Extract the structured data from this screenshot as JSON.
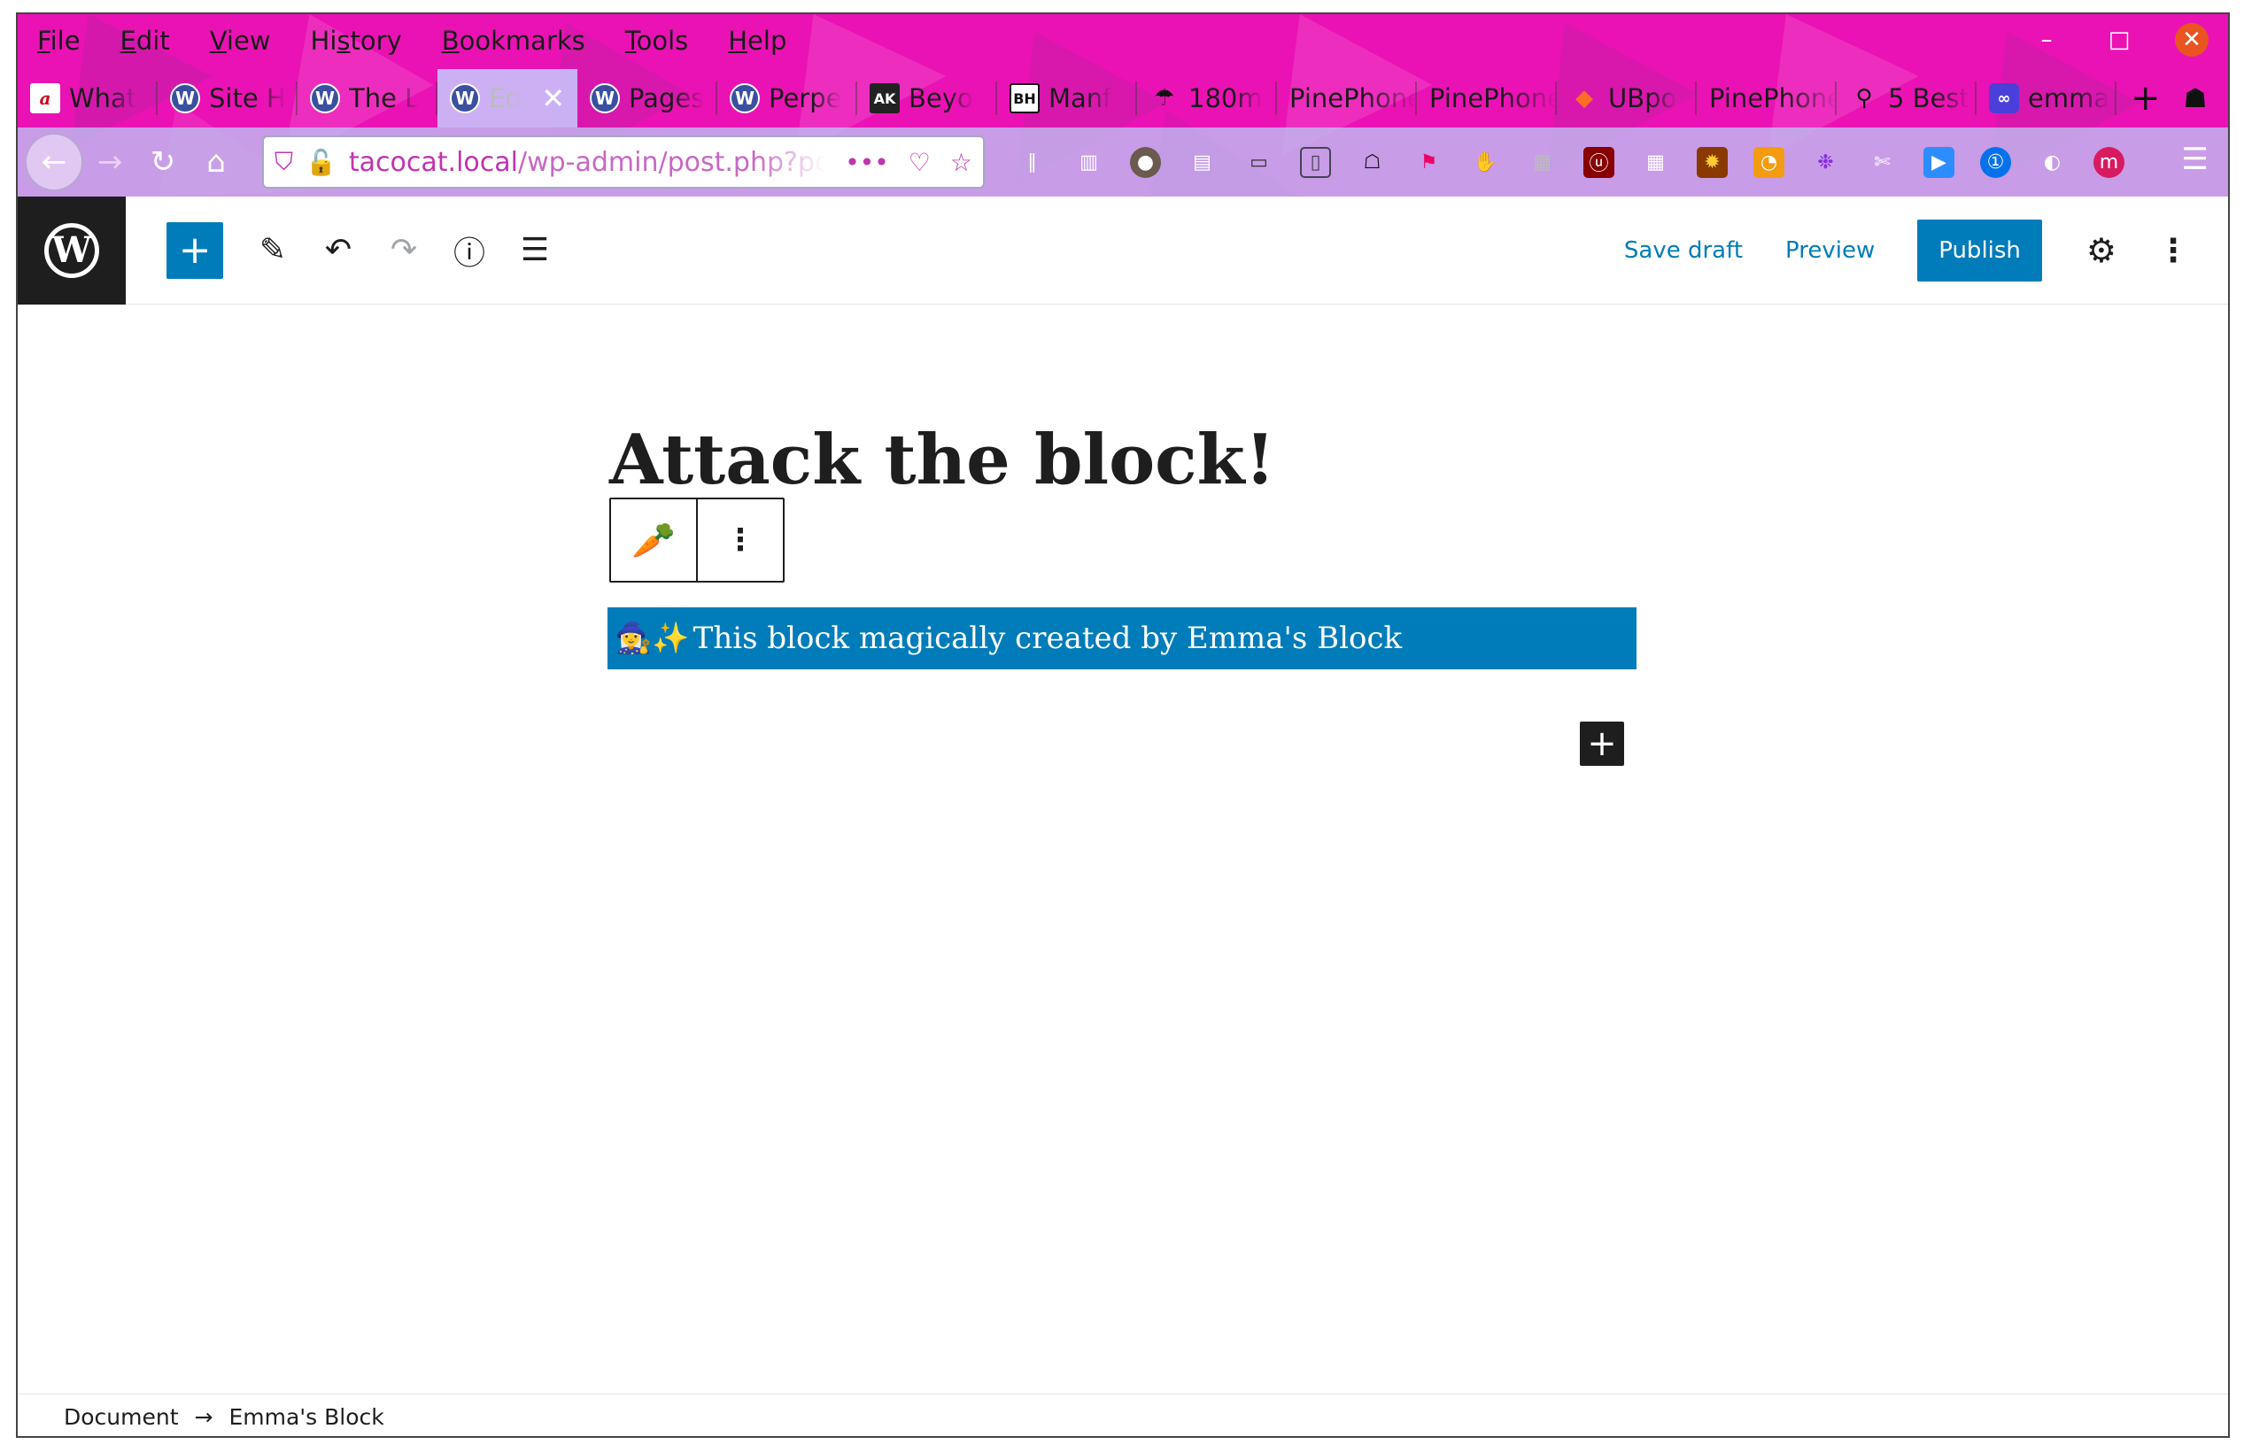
{
  "menu": [
    "File",
    "Edit",
    "View",
    "History",
    "Bookmarks",
    "Tools",
    "Help"
  ],
  "menu_underline": [
    "F",
    "E",
    "V",
    "s",
    "B",
    "T",
    "H"
  ],
  "window_controls": {
    "minimize": "–",
    "maximize": "□",
    "close": "✕"
  },
  "tabs": [
    {
      "label": "What",
      "icon": "a-icon",
      "active": false
    },
    {
      "label": "Site H",
      "icon": "wordpress-icon",
      "active": false
    },
    {
      "label": "The L",
      "icon": "wordpress-icon",
      "active": false
    },
    {
      "label": "Ed",
      "icon": "wordpress-icon",
      "active": true
    },
    {
      "label": "Pages",
      "icon": "wordpress-icon",
      "active": false
    },
    {
      "label": "Perpe",
      "icon": "wordpress-icon",
      "active": false
    },
    {
      "label": "Beyo",
      "icon": "ak-icon",
      "active": false
    },
    {
      "label": "Manf",
      "icon": "bh-icon",
      "active": false
    },
    {
      "label": "180m",
      "icon": "umbrella-icon",
      "active": false
    },
    {
      "label": "PinePhone",
      "icon": "",
      "active": false
    },
    {
      "label": "PinePhone",
      "icon": "",
      "active": false
    },
    {
      "label": "UBpo",
      "icon": "gitlab-icon",
      "active": false
    },
    {
      "label": "PinePhone",
      "icon": "",
      "active": false
    },
    {
      "label": "5 Best",
      "icon": "telescope-icon",
      "active": false
    },
    {
      "label": "emma",
      "icon": "infinity-icon",
      "active": false
    }
  ],
  "tab_badges": {
    "ak": "AK",
    "bh": "BH",
    "a": "a",
    "wp": "W"
  },
  "tab_new": "+",
  "url": {
    "host": "tacocat.local",
    "path": "/wp-admin/post.php?post=",
    "dots": "•••"
  },
  "wp": {
    "toolbar": {
      "add": "+",
      "save_draft": "Save draft",
      "preview": "Preview",
      "publish": "Publish"
    },
    "logo": "W",
    "title": "Attack the block!",
    "block_text": "This block magically created by Emma's Block",
    "block_emoji": "🧙‍♀️✨",
    "inserter": "+",
    "breadcrumb": [
      "Document",
      "Emma's Block"
    ],
    "breadcrumb_sep": "→"
  },
  "colors": {
    "wp_blue": "#007cba",
    "wp_dark": "#1e1e1e",
    "theme_pink": "#ea12b4"
  }
}
